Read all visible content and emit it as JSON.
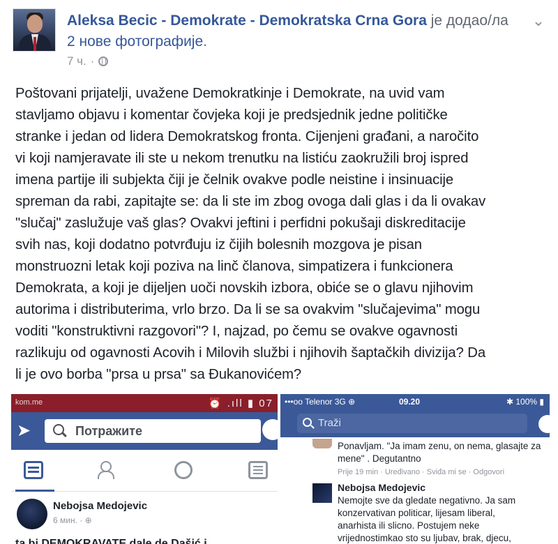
{
  "post": {
    "author": "Aleksa Becic - Demokrate - Demokratska Crna Gora",
    "verb": "је додао/ла",
    "photos_link": "2 нове фотографије",
    "time": "7 ч.",
    "body": "Poštovani prijatelji, uvažene Demokratkinje i Demokrate, na uvid vam\nstavljamo objavu i komentar čovjeka koji je predsjednik jedne političke\nstranke i jedan od lidera Demokratskog fronta. Cijenjeni građani, a naročito\nvi koji namjeravate ili ste u nekom trenutku na listiću zaokružili broj ispred\nimena partije ili subjekta čiji je čelnik ovakve podle neistine i insinuacije\nspreman da rabi, zapitajte se: da li ste im zbog ovoga dali glas i da li ovakav\n\"slučaj\" zaslužuje vaš glas? Ovakvi jeftini i perfidni pokušaji diskreditacije\nsvih nas, koji dodatno potvrđuju iz čijih bolesnih mozgova je pisan\nmonstruozni letak koji poziva na linč članova, simpatizera i funkcionera\nDemokrata, a koji je dijeljen uoči novskih izbora, obiće se o glavu njihovim\nautorima i distributerima, vrlo brzo. Da li se sa ovakvim \"slučajevima\" mogu\nvoditi \"konstruktivni razgovori\"? I, najzad, po čemu se ovakve ogavnosti\nrazlikuju od ogavnosti Acovih i Milovih službi i njihovih šaptačkih divizija? Da\nli je ovo borba \"prsa u prsa\" sa Đukanovićem?"
  },
  "screenshot_left": {
    "carrier": "kom.me",
    "status_icons": "⏰ .ıll ▮ 07",
    "search_placeholder": "Потражите",
    "post_author": "Nebojsa Medojevic",
    "post_time": "6 мин. · ⊕",
    "post_text": "ta bi DEMOKRAVATE dale de Dašić i"
  },
  "screenshot_right": {
    "carrier": "•••oo Telenor  3G  ⊕",
    "time": "09.20",
    "battery": "✱ 100% ▮",
    "search_placeholder": "Traži",
    "comment1_text": "Ponavljam. \"Ja imam zenu, on nema, glasajte za mene\" . Degutantno",
    "comment1_meta": "Prije 19 min · Uređivano · Sviđa mi se · Odgovori",
    "comment2_author": "Nebojsa Medojevic",
    "comment2_text": "Nemojte sve da gledate negativno. Ja sam\nkonzervativan politicar, lijesam liberal,\nanarhista ili slicno. Postujem neke\nvrijednostimkao sto su ljubav, brak, djecu,"
  }
}
